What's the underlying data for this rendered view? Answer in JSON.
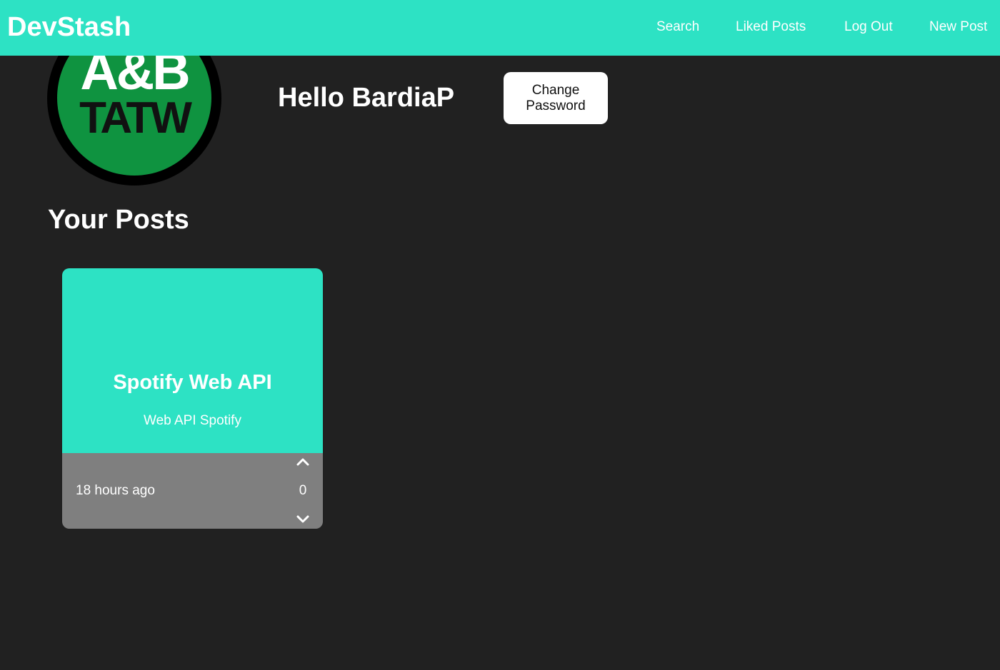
{
  "navbar": {
    "brand": "DevStash",
    "links": {
      "search": "Search",
      "liked_posts": "Liked Posts",
      "log_out": "Log Out",
      "new_post": "New Post"
    }
  },
  "profile": {
    "avatar_logo_text_top": "A&B",
    "avatar_logo_text_bottom": "TATW",
    "greeting": "Hello BardiaP",
    "change_password_line1": "Change",
    "change_password_line2": "Password"
  },
  "posts_section": {
    "title": "Your Posts",
    "posts": [
      {
        "title": "Spotify Web API",
        "tags": "Web API Spotify",
        "time": "18 hours ago",
        "votes": "0"
      }
    ]
  },
  "colors": {
    "accent": "#2de2c4",
    "background": "#212121",
    "card_footer": "#7f7f7f",
    "avatar_green": "#0f9340"
  },
  "icons": {
    "upvote": "chevron-up-icon",
    "downvote": "chevron-down-icon"
  }
}
